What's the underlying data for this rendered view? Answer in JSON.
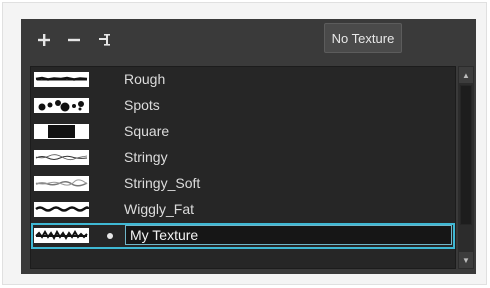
{
  "toolbar": {
    "add_icon": "plus-icon",
    "remove_icon": "minus-icon",
    "rename_icon": "rename-texture-icon",
    "no_texture_label": "No Texture"
  },
  "textures": [
    {
      "name": "Rough",
      "preview": "rough"
    },
    {
      "name": "Spots",
      "preview": "spots"
    },
    {
      "name": "Square",
      "preview": "square"
    },
    {
      "name": "Stringy",
      "preview": "stringy"
    },
    {
      "name": "Stringy_Soft",
      "preview": "stringy-soft"
    },
    {
      "name": "Wiggly_Fat",
      "preview": "wiggly-fat"
    },
    {
      "name": "My Texture",
      "preview": "my-texture",
      "selected": true
    }
  ],
  "colors": {
    "panel_bg": "#3a3a3a",
    "list_bg": "#262626",
    "selection_accent": "#3fb8d4"
  }
}
